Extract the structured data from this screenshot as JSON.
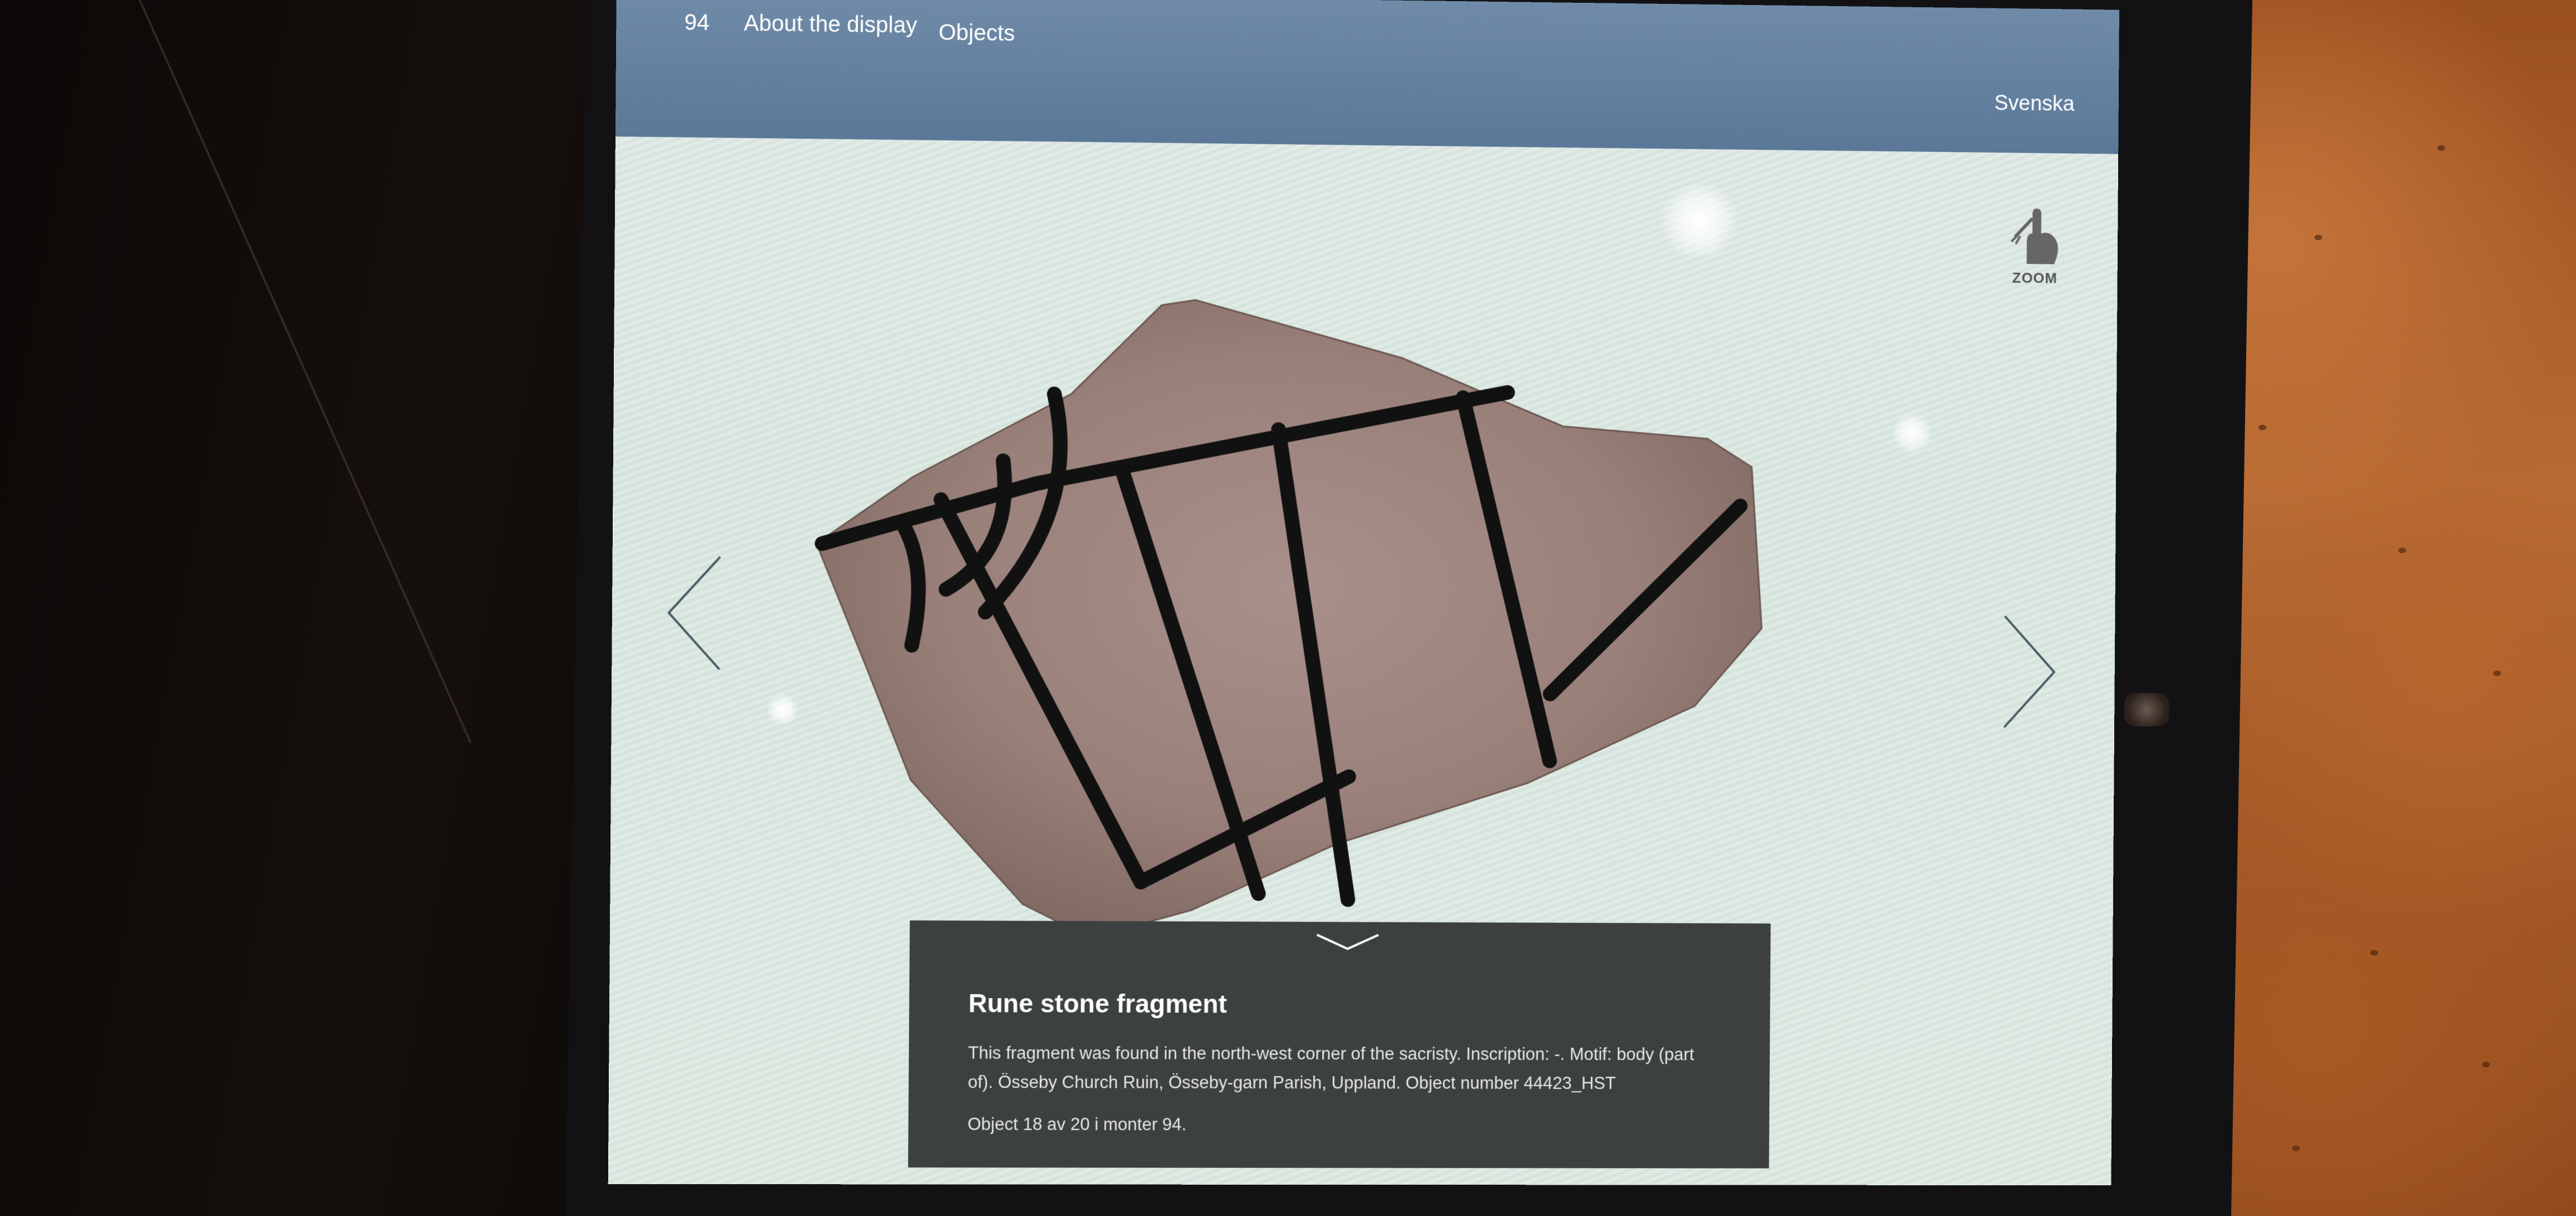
{
  "nav": {
    "number": "94",
    "about": "About the display",
    "objects": "Objects"
  },
  "language": "Svenska",
  "zoom": {
    "label": "ZOOM",
    "icon": "pinch-zoom-hand-icon"
  },
  "object": {
    "title": "Rune stone fragment",
    "description": "This fragment was found in the north-west corner of the sacristy. Inscription: -. Motif: body (part of). Össeby Church Ruin, Össeby-garn Parish, Uppland. Object number 44423_HST",
    "count": "Object 18 av 20 i monter 94."
  },
  "colors": {
    "topbar": "#5b7898",
    "panel": "#3c403f",
    "stone": "#9c7f79",
    "carving": "#111111",
    "wall": "#b86b33"
  }
}
